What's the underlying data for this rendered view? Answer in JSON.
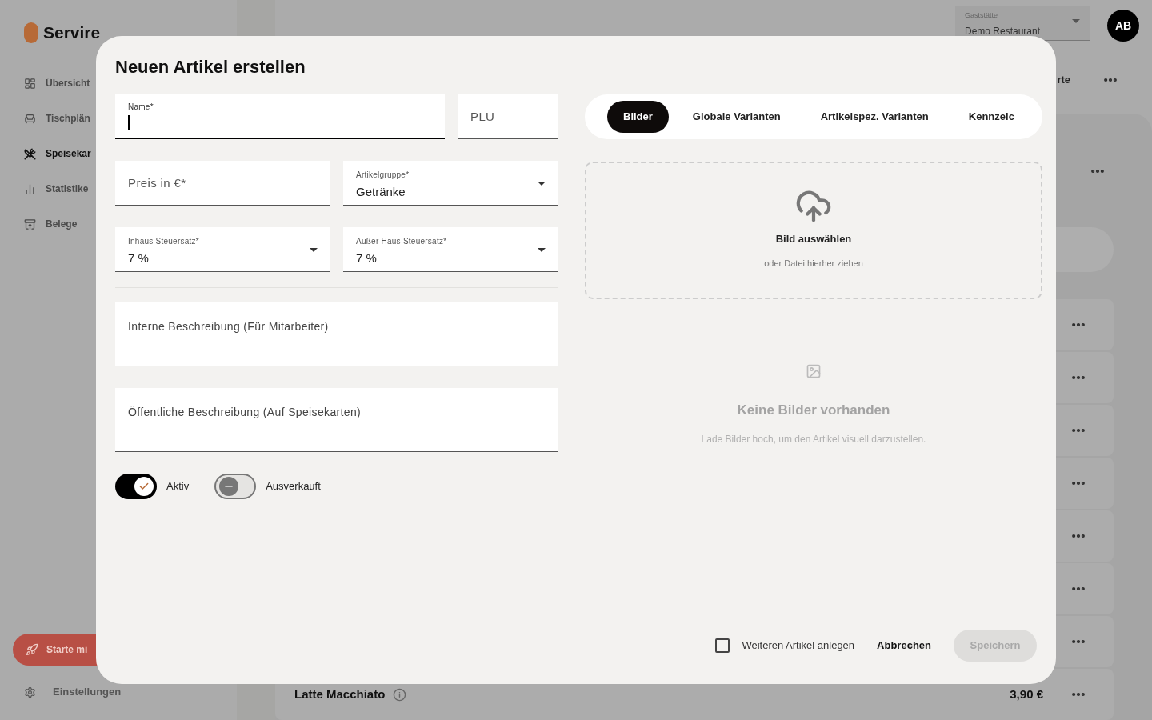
{
  "app": {
    "logo": "Servire",
    "nav": [
      {
        "label": "Übersicht",
        "selected": false
      },
      {
        "label": "Tischplän",
        "selected": false
      },
      {
        "label": "Speisekar",
        "selected": true
      },
      {
        "label": "Statistike",
        "selected": false
      },
      {
        "label": "Belege",
        "selected": false
      }
    ],
    "promo_button": "Starte mi",
    "settings": "Einstellungen",
    "venue_select": {
      "label": "Gaststätte",
      "value": "Demo Restaurant"
    },
    "avatar": "AB",
    "heading": "rte",
    "last_row": {
      "name": "Latte Macchiato",
      "price": "3,90 €"
    }
  },
  "dialog": {
    "title": "Neuen Artikel erstellen",
    "fields": [
      [
        {
          "kind": "text",
          "label": "Name*",
          "focused": true
        },
        {
          "kind": "text",
          "placeholder": "PLU",
          "focused": false
        }
      ],
      [
        {
          "kind": "text",
          "placeholder": "Preis in €*",
          "focused": false
        },
        {
          "kind": "select",
          "label": "Artikelgruppe*",
          "value": "Getränke"
        }
      ],
      [
        {
          "kind": "select",
          "label": "Inhaus Steuersatz*",
          "value": "7 %"
        },
        {
          "kind": "select",
          "label": "Außer Haus Steuersatz*",
          "value": "7 %"
        }
      ]
    ],
    "descriptions": [
      {
        "placeholder": "Interne Beschreibung (Für Mitarbeiter)"
      },
      {
        "placeholder": "Öffentliche Beschreibung (Auf Speisekarten)"
      }
    ],
    "toggles": [
      {
        "label": "Aktiv",
        "on": true
      },
      {
        "label": "Ausverkauft",
        "on": false
      }
    ],
    "tabs": [
      {
        "label": "Bilder",
        "selected": true
      },
      {
        "label": "Globale Varianten",
        "selected": false
      },
      {
        "label": "Artikelspez. Varianten",
        "selected": false
      },
      {
        "label": "Kennzeic",
        "selected": false
      }
    ],
    "dropzone": {
      "title": "Bild auswählen",
      "subtitle": "oder Datei hierher ziehen"
    },
    "empty_state": {
      "title": "Keine Bilder vorhanden",
      "subtitle": "Lade Bilder hoch, um den Artikel visuell darzustellen."
    },
    "footer": {
      "checkbox": {
        "label": "Weiteren Artikel anlegen",
        "checked": false
      },
      "cancel": "Abbrechen",
      "save": {
        "label": "Speichern",
        "disabled": true
      }
    }
  }
}
